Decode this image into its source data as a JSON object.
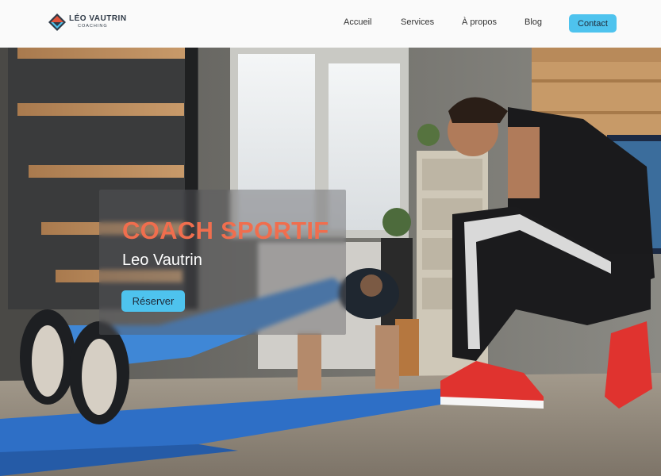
{
  "brand": {
    "name": "LÉO VAUTRIN",
    "tagline": "COACHING",
    "logo_icon": "diamond-logo-icon"
  },
  "nav": {
    "items": [
      {
        "label": "Accueil"
      },
      {
        "label": "Services"
      },
      {
        "label": "À propos"
      },
      {
        "label": "Blog"
      }
    ],
    "cta_label": "Contact"
  },
  "hero": {
    "title": "COACH SPORTIF",
    "subtitle": "Leo Vautrin",
    "cta_label": "Réserver"
  },
  "colors": {
    "accent": "#4ec3ee",
    "title": "#f06e4e",
    "logo_dark": "#2f3a47",
    "logo_red": "#e0533a"
  }
}
